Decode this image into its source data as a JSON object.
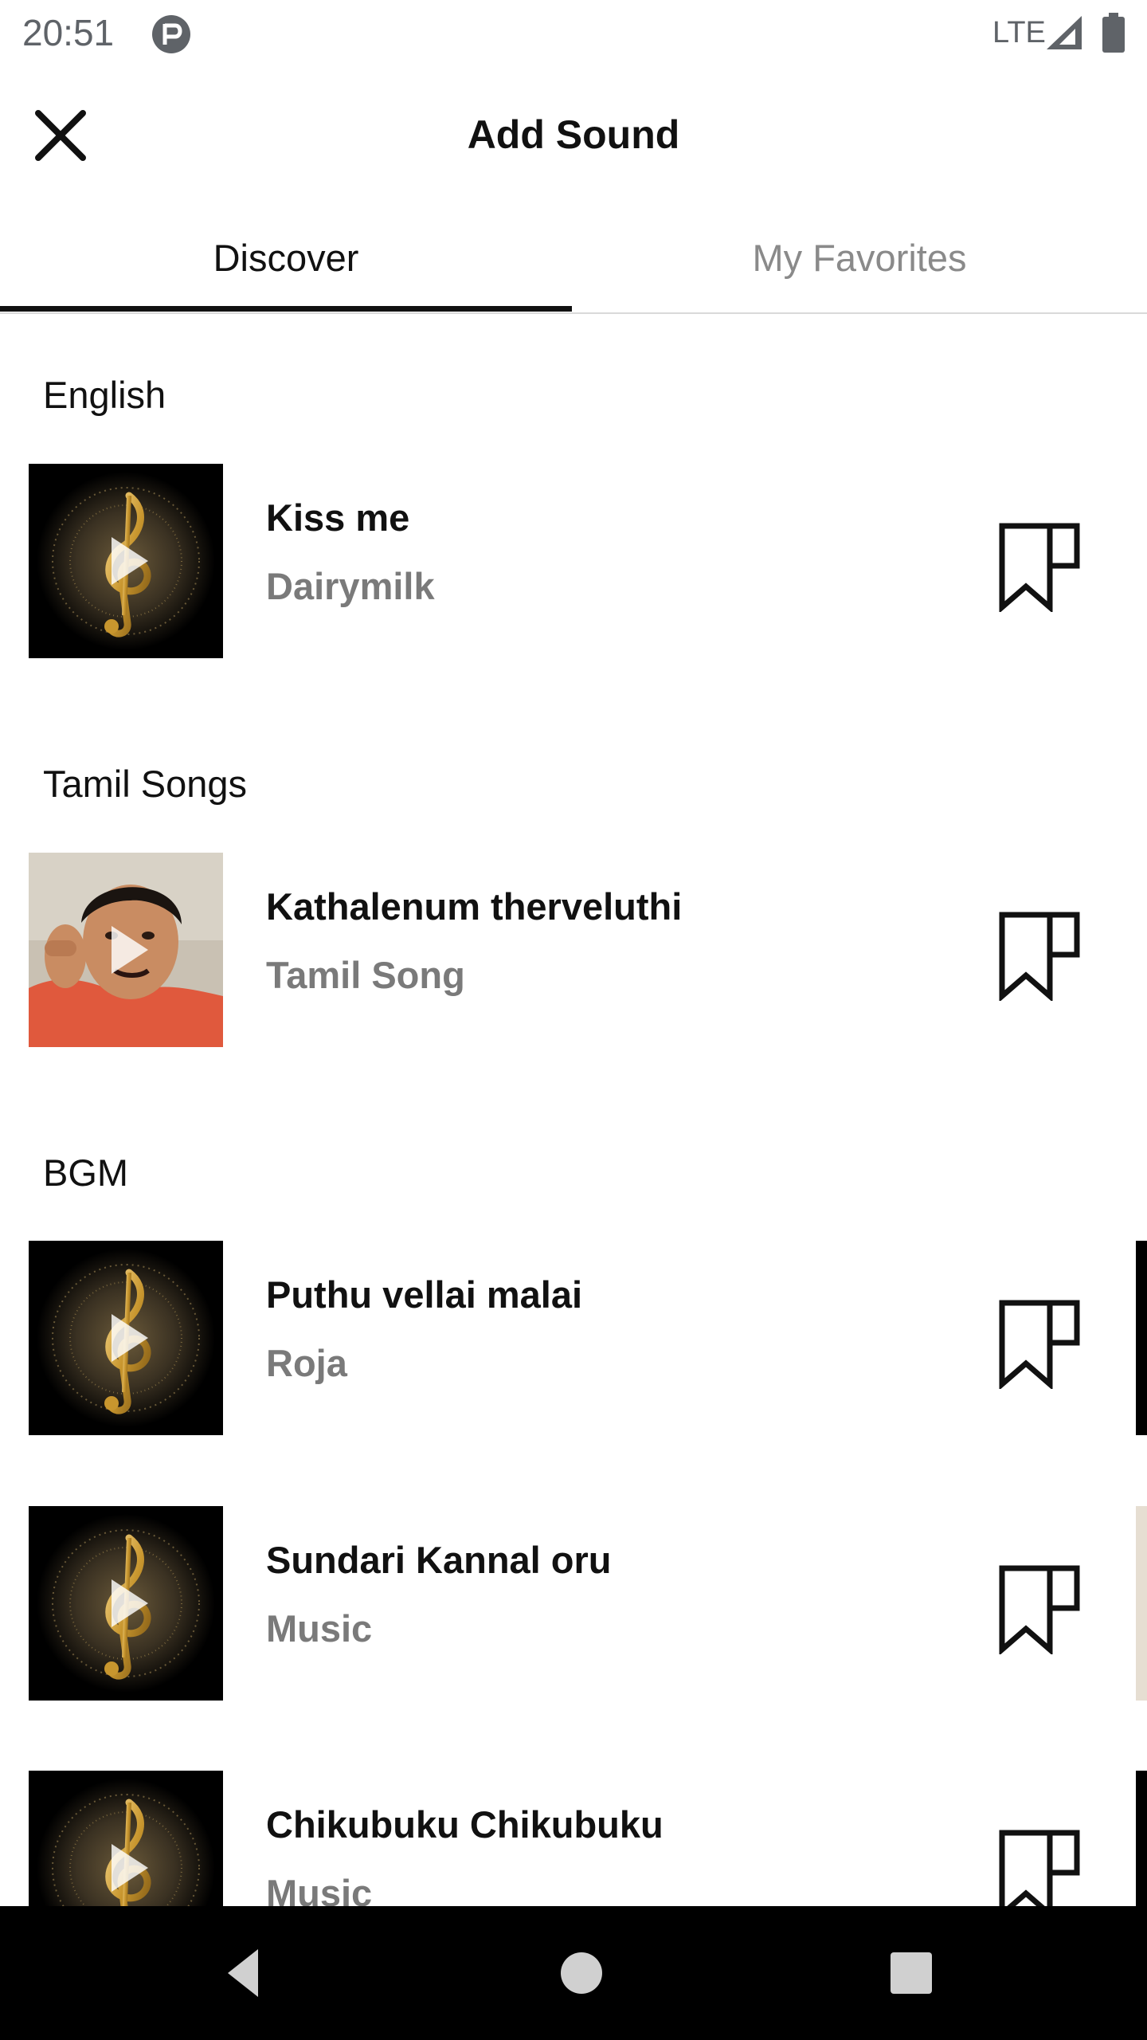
{
  "status_bar": {
    "time": "20:51",
    "network": "LTE"
  },
  "header": {
    "title": "Add Sound"
  },
  "tabs": [
    {
      "label": "Discover",
      "selected": true
    },
    {
      "label": "My Favorites",
      "selected": false
    }
  ],
  "sections": [
    {
      "label": "English"
    },
    {
      "label": "Tamil Songs"
    },
    {
      "label": "BGM"
    }
  ],
  "songs": [
    {
      "title": "Kiss me",
      "artist": "Dairymilk",
      "thumbnail": "gold-treble-clef"
    },
    {
      "title": "Kathalenum therveluthi",
      "artist": "Tamil Song",
      "thumbnail": "man-pointing-photo"
    },
    {
      "title": "Puthu vellai malai",
      "artist": "Roja",
      "thumbnail": "gold-treble-clef"
    },
    {
      "title": "Sundari Kannal oru",
      "artist": "Music",
      "thumbnail": "gold-treble-clef"
    },
    {
      "title": "Chikubuku Chikubuku",
      "artist": "Music",
      "thumbnail": "gold-treble-clef"
    }
  ],
  "icons": {
    "close": "close-icon",
    "bookmark": "bookmark-icon",
    "play": "play-icon",
    "nav_back": "back-icon",
    "nav_home": "home-icon",
    "nav_recents": "recents-icon"
  },
  "colors": {
    "text_primary": "#111111",
    "text_secondary": "#7a7a7a",
    "tab_inactive": "#8a8a8a",
    "tab_indicator": "#111111",
    "nav_bar": "#000000"
  }
}
